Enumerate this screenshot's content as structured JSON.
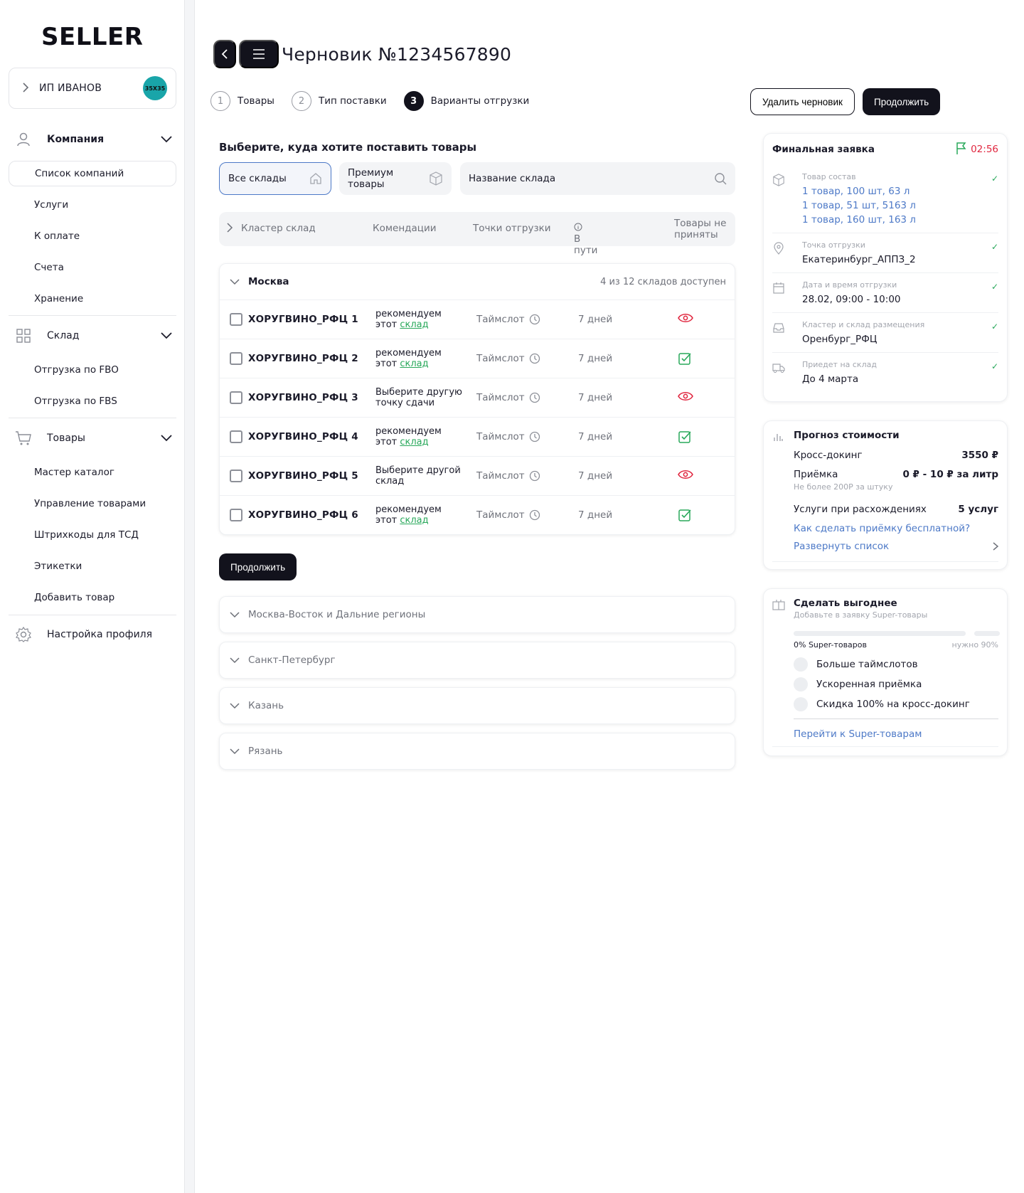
{
  "sidebar": {
    "logo": "SELLER",
    "account": {
      "name": "ИП ИВАНОВ",
      "avatar": "35X35"
    },
    "company": {
      "title": "Компания",
      "items": [
        "Список компаний",
        "Услуги",
        "К оплате",
        "Счета",
        "Хранение"
      ]
    },
    "warehouse": {
      "title": "Склад",
      "items": [
        "Отгрузка по FBO",
        "Отгрузка по FBS"
      ]
    },
    "goods": {
      "title": "Товары",
      "items": [
        "Мастер каталог",
        "Управление товарами",
        "Штрихкоды для ТСД",
        "Этикетки",
        "Добавить товар"
      ]
    },
    "settings": "Настройка профиля"
  },
  "header": {
    "title": "Черновик №1234567890",
    "steps": [
      {
        "num": "1",
        "label": "Товары"
      },
      {
        "num": "2",
        "label": "Тип поставки"
      },
      {
        "num": "3",
        "label": "Варианты отгрузки"
      }
    ],
    "delete_label": "Удалить черновик",
    "continue_label": "Продолжить"
  },
  "main": {
    "section_title": "Выберите, куда хотите поставить товары",
    "filters": {
      "all": "Все склады",
      "premium": "Премиум товары",
      "search_placeholder": "Название склада"
    },
    "columns": {
      "cluster": "Кластер склад",
      "recs": "Комендации",
      "points": "Точки отгрузки",
      "transit": "В пути",
      "not_accepted": "Товары не приняты"
    },
    "moscow": {
      "name": "Москва",
      "availability": "4 из 12 складов доступен",
      "rows": [
        {
          "name": "ХОРУГВИНО_РФЦ 1",
          "rec1": "рекомендуем",
          "rec2": "этот ",
          "link": "склад",
          "slot": "Таймслот",
          "days": "7 дней",
          "status": "eye"
        },
        {
          "name": "ХОРУГВИНО_РФЦ 2",
          "rec1": "рекомендуем",
          "rec2": "этот ",
          "link": "склад",
          "slot": "Таймслот",
          "days": "7 дней",
          "status": "check"
        },
        {
          "name": "ХОРУГВИНО_РФЦ 3",
          "rec1": "Выберите другую",
          "rec2": "точку сдачи",
          "link": "",
          "slot": "Таймслот",
          "days": "7 дней",
          "status": "eye"
        },
        {
          "name": "ХОРУГВИНО_РФЦ 4",
          "rec1": "рекомендуем",
          "rec2": "этот ",
          "link": "склад",
          "slot": "Таймслот",
          "days": "7 дней",
          "status": "check"
        },
        {
          "name": "ХОРУГВИНО_РФЦ 5",
          "rec1": "Выберите другой",
          "rec2": "склад",
          "link": "",
          "slot": "Таймслот",
          "days": "7 дней",
          "status": "eye"
        },
        {
          "name": "ХОРУГВИНО_РФЦ 6",
          "rec1": "рекомендуем",
          "rec2": "этот ",
          "link": "склад",
          "slot": "Таймслот",
          "days": "7 дней",
          "status": "check"
        }
      ]
    },
    "continue_label": "Продолжить",
    "regions": [
      "Москва-Восток и Дальние регионы",
      "Санкт-Петербург",
      "Казань",
      "Рязань"
    ]
  },
  "final": {
    "title": "Финальная заявка",
    "timer": "02:56",
    "goods_label": "Товар состав",
    "goods": [
      "1 товар, 100 шт, 63 л",
      "1 товар, 51 шт, 5163 л",
      "1 товар, 160 шт, 163 л"
    ],
    "point_label": "Точка отгрузки",
    "point": "Екатеринбург_АППЗ_2",
    "date_label": "Дата и время отгрузки",
    "date": "28.02, 09:00 - 10:00",
    "cluster_label": "Кластер и склад размещения",
    "cluster": "Оренбург_РФЦ",
    "arrive_label": "Приедет на склад",
    "arrive": "До 4 марта"
  },
  "forecast": {
    "title": "Прогноз стоимости",
    "cross_label": "Кросс-докинг",
    "cross_value": "3550 ₽",
    "accept_label": "Приёмка",
    "accept_value": "0 ₽ - 10 ₽ за литр",
    "accept_note": "Не более 200Р за штуку",
    "services_label": "Услуги при расхождениях",
    "services_value": "5 услуг",
    "free_link": "Как сделать приёмку бесплатной?",
    "expand_link": "Развернуть список"
  },
  "better": {
    "title": "Сделать выгоднее",
    "subtitle": "Добавьте в заявку Super-товары",
    "progress": 0,
    "progress_label": "0% Super-товаров",
    "need_label": "нужно 90%",
    "options": [
      "Больше таймслотов",
      "Ускоренная приёмка",
      "Скидка 100% на кросс-докинг"
    ],
    "link": "Перейти к Super-товарам"
  },
  "colors": {
    "accent": "#12121c",
    "link": "#4d79c7",
    "green": "#28a85a",
    "red": "#e0263f"
  }
}
